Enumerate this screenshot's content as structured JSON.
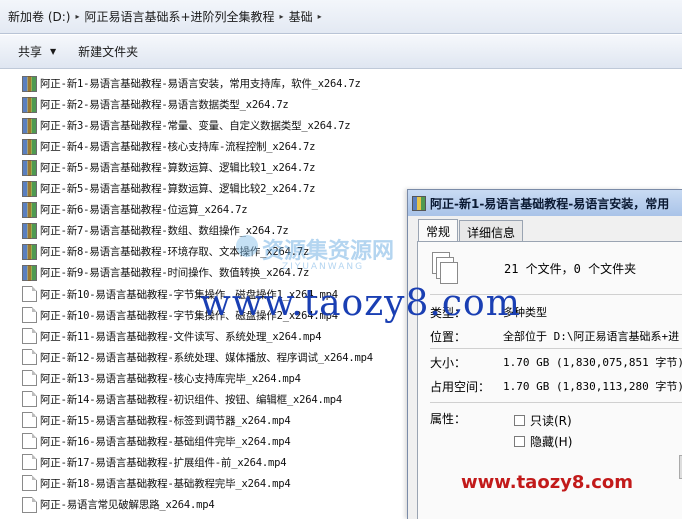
{
  "address_bar": {
    "crumbs": [
      "新加卷 (D:)",
      "阿正易语言基础系+进阶列全集教程",
      "基础"
    ]
  },
  "toolbar": {
    "share_label": "共享",
    "new_folder_label": "新建文件夹"
  },
  "files": [
    {
      "name": "阿正-新1-易语言基础教程-易语言安装，常用支持库，软件_x264.7z",
      "type": "archive"
    },
    {
      "name": "阿正-新2-易语言基础教程-易语言数据类型_x264.7z",
      "type": "archive"
    },
    {
      "name": "阿正-新3-易语言基础教程-常量、变量、自定义数据类型_x264.7z",
      "type": "archive"
    },
    {
      "name": "阿正-新4-易语言基础教程-核心支持库-流程控制_x264.7z",
      "type": "archive"
    },
    {
      "name": "阿正-新5-易语言基础教程-算数运算、逻辑比较1_x264.7z",
      "type": "archive"
    },
    {
      "name": "阿正-新5-易语言基础教程-算数运算、逻辑比较2_x264.7z",
      "type": "archive"
    },
    {
      "name": "阿正-新6-易语言基础教程-位运算_x264.7z",
      "type": "archive"
    },
    {
      "name": "阿正-新7-易语言基础教程-数组、数组操作_x264.7z",
      "type": "archive"
    },
    {
      "name": "阿正-新8-易语言基础教程-环境存取、文本操作_x264.7z",
      "type": "archive"
    },
    {
      "name": "阿正-新9-易语言基础教程-时间操作、数值转换_x264.7z",
      "type": "archive"
    },
    {
      "name": "阿正-新10-易语言基础教程-字节集操作、磁盘操作1_x264.mp4",
      "type": "video"
    },
    {
      "name": "阿正-新10-易语言基础教程-字节集操作、磁盘操作2_x264.mp4",
      "type": "video"
    },
    {
      "name": "阿正-新11-易语言基础教程-文件读写、系统处理_x264.mp4",
      "type": "video"
    },
    {
      "name": "阿正-新12-易语言基础教程-系统处理、媒体播放、程序调试_x264.mp4",
      "type": "video"
    },
    {
      "name": "阿正-新13-易语言基础教程-核心支持库完毕_x264.mp4",
      "type": "video"
    },
    {
      "name": "阿正-新14-易语言基础教程-初识组件、按钮、编辑框_x264.mp4",
      "type": "video"
    },
    {
      "name": "阿正-新15-易语言基础教程-标签到调节器_x264.mp4",
      "type": "video"
    },
    {
      "name": "阿正-新16-易语言基础教程-基础组件完毕_x264.mp4",
      "type": "video"
    },
    {
      "name": "阿正-新17-易语言基础教程-扩展组件-前_x264.mp4",
      "type": "video"
    },
    {
      "name": "阿正-新18-易语言基础教程-基础教程完毕_x264.mp4",
      "type": "video"
    },
    {
      "name": "阿正-易语言常见破解思路_x264.mp4",
      "type": "video"
    }
  ],
  "dialog": {
    "title": "阿正-新1-易语言基础教程-易语言安装，常用",
    "tabs": [
      "常规",
      "详细信息"
    ],
    "summary": "21 个文件，0 个文件夹",
    "type_label": "类型：",
    "type_value": "多种类型",
    "location_label": "位置：",
    "location_value": "全部位于 D:\\阿正易语言基础系+进",
    "size_label": "大小：",
    "size_value": "1.70 GB (1,830,075,851 字节)",
    "disk_size_label": "占用空间：",
    "disk_size_value": "1.70 GB (1,830,113,280 字节)",
    "attributes_label": "属性：",
    "readonly_label": "只读(R)",
    "hidden_label": "隐藏(H)"
  },
  "watermarks": {
    "large": "www.taozy8.com",
    "small": "www.taozy8.com",
    "logo_main": "资源集资源网",
    "logo_sub": "ZIYUANWANG"
  },
  "colors": {
    "watermark_blue": "#1a3fb3",
    "watermark_red": "#c21a1a",
    "titlebar": "#b9cfee"
  }
}
